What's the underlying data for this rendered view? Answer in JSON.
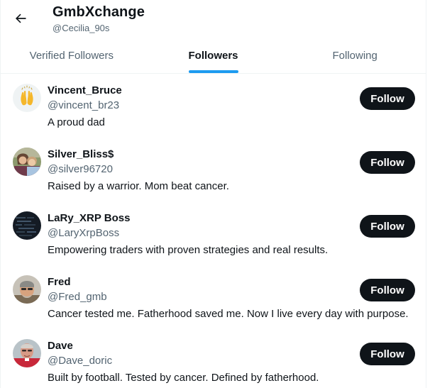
{
  "header": {
    "title": "GmbXchange",
    "handle": "@Cecilia_90s"
  },
  "tabs": [
    {
      "label": "Verified Followers",
      "active": false
    },
    {
      "label": "Followers",
      "active": true
    },
    {
      "label": "Following",
      "active": false
    }
  ],
  "users": [
    {
      "name": "Vincent_Bruce",
      "handle": "@vincent_br23",
      "bio": "A proud dad",
      "follow_label": "Follow",
      "avatar_icon": "raised-hands-emoji"
    },
    {
      "name": "Silver_Bliss$",
      "handle": "@silver96720",
      "bio": "Raised by a warrior. Mom beat cancer.",
      "follow_label": "Follow",
      "avatar_icon": "photo"
    },
    {
      "name": "LaRy_XRP Boss",
      "handle": "@LaryXrpBoss",
      "bio": "Empowering traders with proven strategies and real results.",
      "follow_label": "Follow",
      "avatar_icon": "photo"
    },
    {
      "name": "Fred",
      "handle": "@Fred_gmb",
      "bio": "Cancer tested me. Fatherhood saved me. Now I live every day with purpose.",
      "follow_label": "Follow",
      "avatar_icon": "photo"
    },
    {
      "name": "Dave",
      "handle": "@Dave_doric",
      "bio": "Built by football. Tested by cancer. Defined by fatherhood.",
      "follow_label": "Follow",
      "avatar_icon": "photo"
    }
  ],
  "colors": {
    "accent": "#1d9bf0",
    "text_primary": "#0f1419",
    "text_secondary": "#536471",
    "button_bg": "#0f1419",
    "button_text": "#ffffff"
  }
}
